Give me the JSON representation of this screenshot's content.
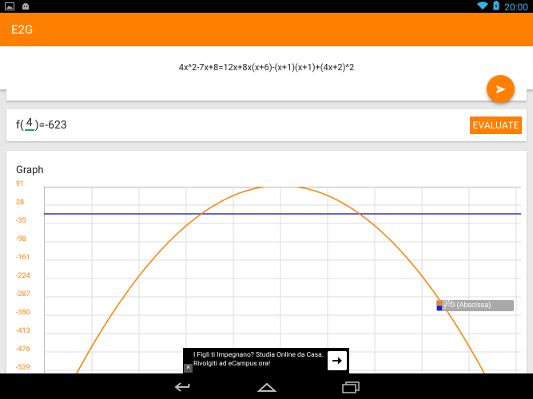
{
  "statusbar": {
    "time": "20:00"
  },
  "app": {
    "title": "E2G"
  },
  "equation": {
    "text": "4x^2-7x+8=12x+8x(x+6)-(x+1)(x+1)+(4x+2)^2"
  },
  "evaluate": {
    "prefix": "f(",
    "input_value": "4",
    "result": ")=-623",
    "button_label": "EVALUATE"
  },
  "graph": {
    "title": "Graph",
    "y_ticks": [
      "91",
      "28",
      "-35",
      "-98",
      "-161",
      "-224",
      "-287",
      "-350",
      "-413",
      "-476",
      "-539"
    ],
    "legend": {
      "series_1": "f(x)",
      "series_2": "y=0 (Abscissa)"
    }
  },
  "ad": {
    "text": "I Figli ti Impegnano? Studia Online da Casa. Rivolgiti ad eCampus ora!",
    "close_label": "×"
  },
  "colors": {
    "accent": "#ff7f00",
    "curve": "#ff7f00",
    "axis_line": "#3333cc",
    "input_underline": "#1e9e6e"
  },
  "chart_data": {
    "type": "line",
    "title": "Graph",
    "ylim": [
      -539,
      91
    ],
    "y_ticks": [
      91,
      28,
      -35,
      -98,
      -161,
      -224,
      -287,
      -350,
      -413,
      -476,
      -539
    ],
    "series": [
      {
        "name": "f(x)",
        "shape": "downward parabola",
        "vertex": {
          "x": 0,
          "y": 100
        },
        "x_range": [
          -5,
          5
        ],
        "y_at_x_4": -623
      },
      {
        "name": "y=0 (Abscissa)",
        "values": [
          0
        ]
      }
    ]
  }
}
